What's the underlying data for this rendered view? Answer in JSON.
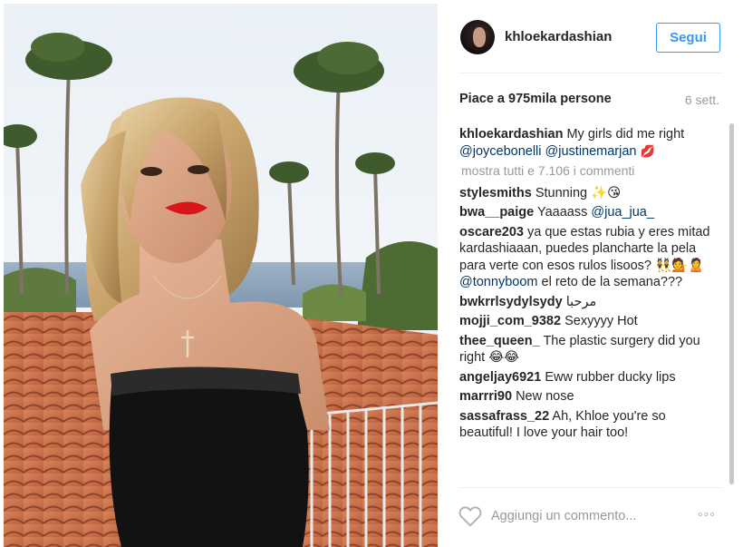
{
  "post": {
    "username": "khloekardashian",
    "follow_label": "Segui",
    "likes_text": "Piace a 975mila persone",
    "age": "6 sett.",
    "show_all_comments": "mostra tutti e 7.106 i commenti",
    "comment_placeholder": "Aggiungi un commento...",
    "more_label": "◦◦◦"
  },
  "caption": {
    "author": "khloekardashian",
    "text": "My girls did me right",
    "mention1": "@joycebonelli",
    "mention2": "@justinemarjan",
    "emoji": "💋"
  },
  "comments": [
    {
      "author": "stylesmiths",
      "text": "Stunning ✨😘"
    },
    {
      "author": "bwa__paige",
      "text": "Yaaaass",
      "mention": "@jua_jua_"
    },
    {
      "author": "oscare203",
      "text": "ya que estas rubia y eres mitad kardashiaaan, puedes plancharte la pela para verte con esos rulos lisoos? 👯💁🙎",
      "mention": "@tonnyboom",
      "text_after": "el reto de la semana???"
    },
    {
      "author": "bwkrrlsydylsydy",
      "text": "مرحبا"
    },
    {
      "author": "mojji_com_9382",
      "text": "Sexyyyy Hot"
    },
    {
      "author": "thee_queen_",
      "text": "The plastic surgery did you right 😂😂"
    },
    {
      "author": "angeljay6921",
      "text": "Eww rubber ducky lips"
    },
    {
      "author": "marrri90",
      "text": "New nose"
    },
    {
      "author": "sassafrass_22",
      "text": "Ah, Khloe you're so beautiful! I love your hair too!"
    }
  ],
  "colors": {
    "accent": "#3897f0",
    "mention": "#003569",
    "muted": "#999999"
  },
  "icons": {
    "like": "heart-outline-icon",
    "more": "more-options-icon"
  }
}
